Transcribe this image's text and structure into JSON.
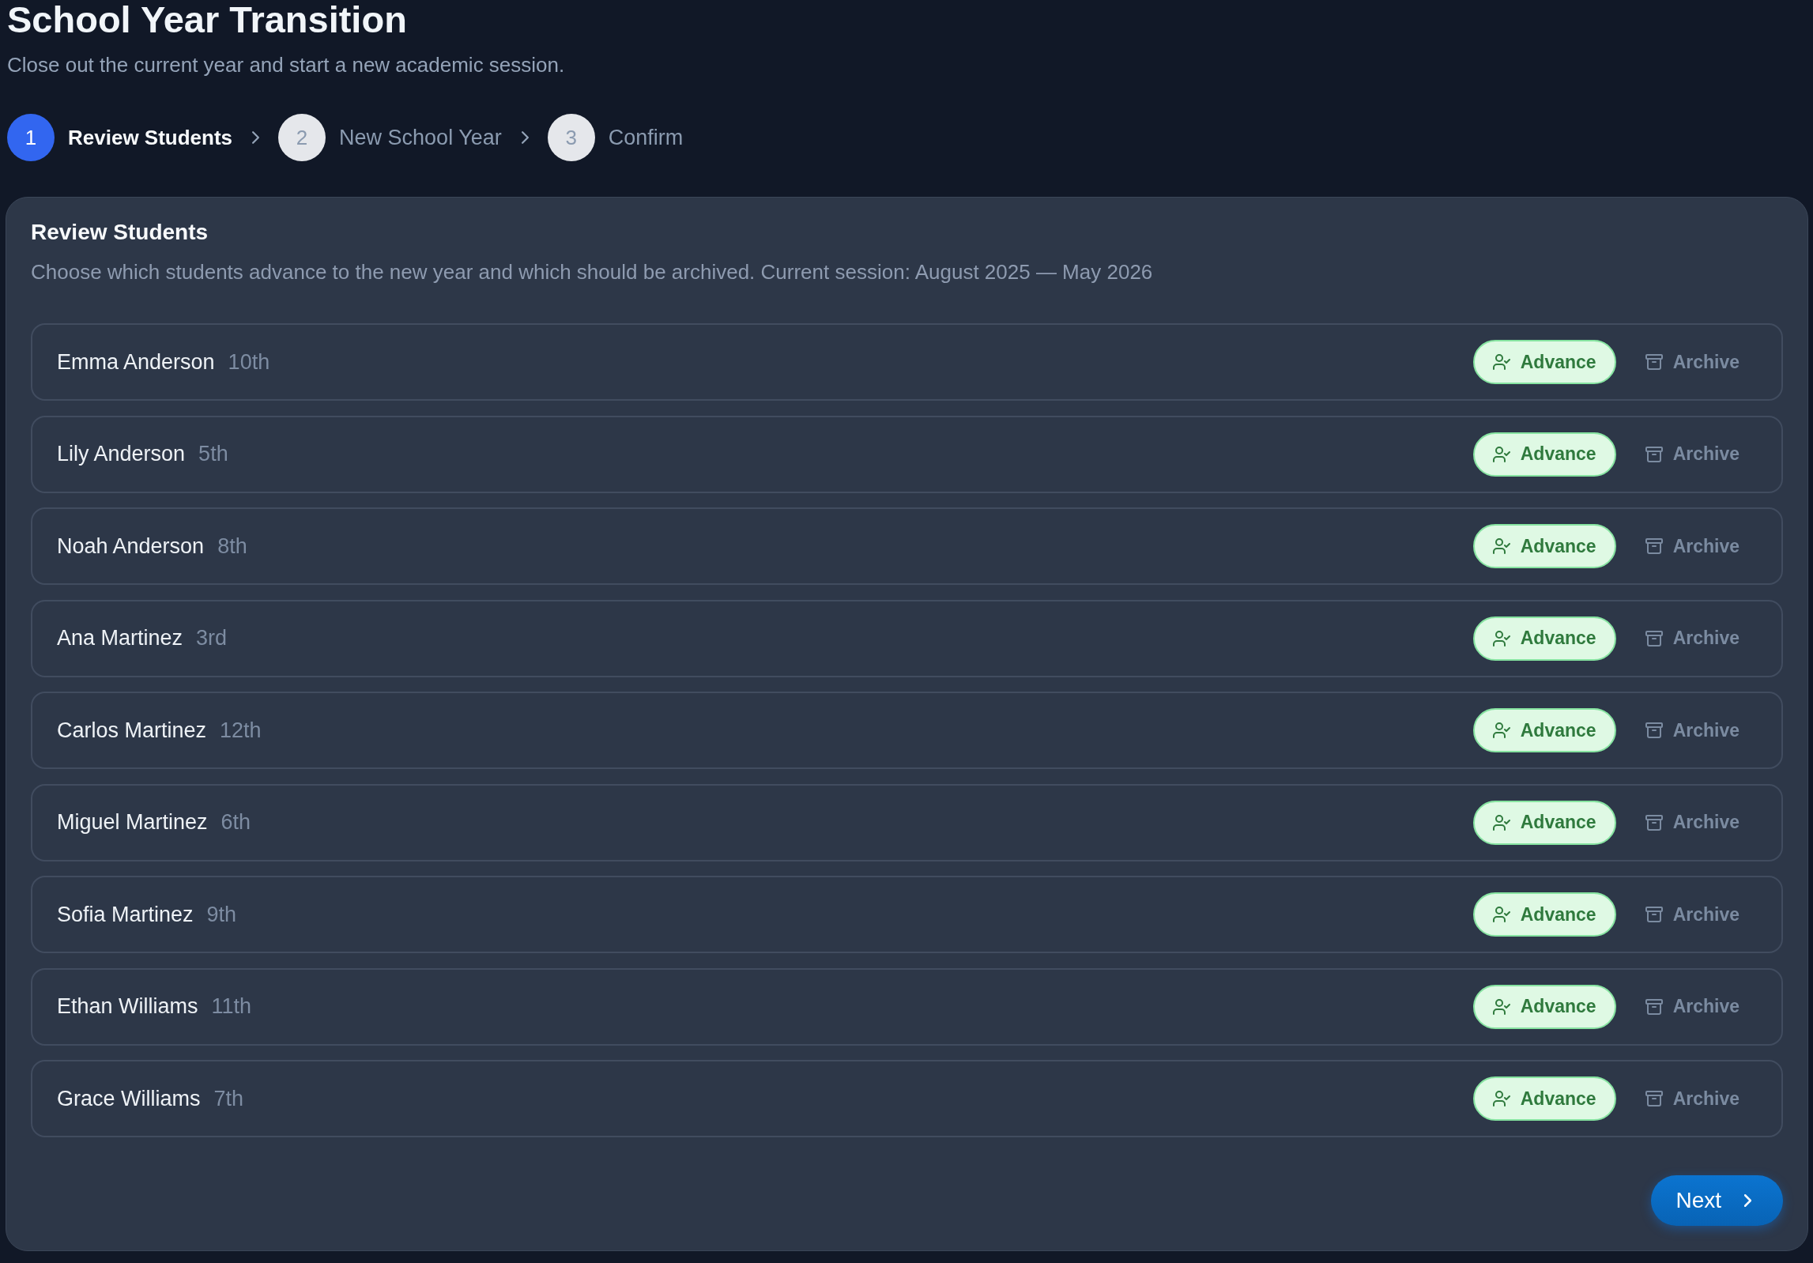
{
  "header": {
    "title": "School Year Transition",
    "subtitle": "Close out the current year and start a new academic session."
  },
  "steps": [
    {
      "number": "1",
      "label": "Review Students",
      "selected": true
    },
    {
      "number": "2",
      "label": "New School Year",
      "selected": false
    },
    {
      "number": "3",
      "label": "Confirm",
      "selected": false
    }
  ],
  "review_card": {
    "title": "Review Students",
    "description": "Choose which students advance to the new year and which should be archived. Current session: August 2025 — May 2026",
    "students": [
      {
        "name": "Emma Anderson",
        "grade": "10th",
        "actions": [
          {
            "kind": "advance",
            "label": "Advance",
            "selected": true
          },
          {
            "kind": "archive",
            "label": "Archive",
            "selected": false
          }
        ]
      },
      {
        "name": "Lily Anderson",
        "grade": "5th",
        "actions": [
          {
            "kind": "advance",
            "label": "Advance",
            "selected": true
          },
          {
            "kind": "archive",
            "label": "Archive",
            "selected": false
          }
        ]
      },
      {
        "name": "Noah Anderson",
        "grade": "8th",
        "actions": [
          {
            "kind": "advance",
            "label": "Advance",
            "selected": true
          },
          {
            "kind": "archive",
            "label": "Archive",
            "selected": false
          }
        ]
      },
      {
        "name": "Ana Martinez",
        "grade": "3rd",
        "actions": [
          {
            "kind": "advance",
            "label": "Advance",
            "selected": true
          },
          {
            "kind": "archive",
            "label": "Archive",
            "selected": false
          }
        ]
      },
      {
        "name": "Carlos Martinez",
        "grade": "12th",
        "actions": [
          {
            "kind": "advance",
            "label": "Advance",
            "selected": true
          },
          {
            "kind": "archive",
            "label": "Archive",
            "selected": false
          }
        ]
      },
      {
        "name": "Miguel Martinez",
        "grade": "6th",
        "actions": [
          {
            "kind": "advance",
            "label": "Advance",
            "selected": true
          },
          {
            "kind": "archive",
            "label": "Archive",
            "selected": false
          }
        ]
      },
      {
        "name": "Sofia Martinez",
        "grade": "9th",
        "actions": [
          {
            "kind": "advance",
            "label": "Advance",
            "selected": true
          },
          {
            "kind": "archive",
            "label": "Archive",
            "selected": false
          }
        ]
      },
      {
        "name": "Ethan Williams",
        "grade": "11th",
        "actions": [
          {
            "kind": "advance",
            "label": "Advance",
            "selected": true
          },
          {
            "kind": "archive",
            "label": "Archive",
            "selected": false
          }
        ]
      },
      {
        "name": "Grace Williams",
        "grade": "7th",
        "actions": [
          {
            "kind": "advance",
            "label": "Advance",
            "selected": true
          },
          {
            "kind": "archive",
            "label": "Archive",
            "selected": false
          }
        ]
      }
    ],
    "next_button": {
      "label": "Next"
    }
  }
}
